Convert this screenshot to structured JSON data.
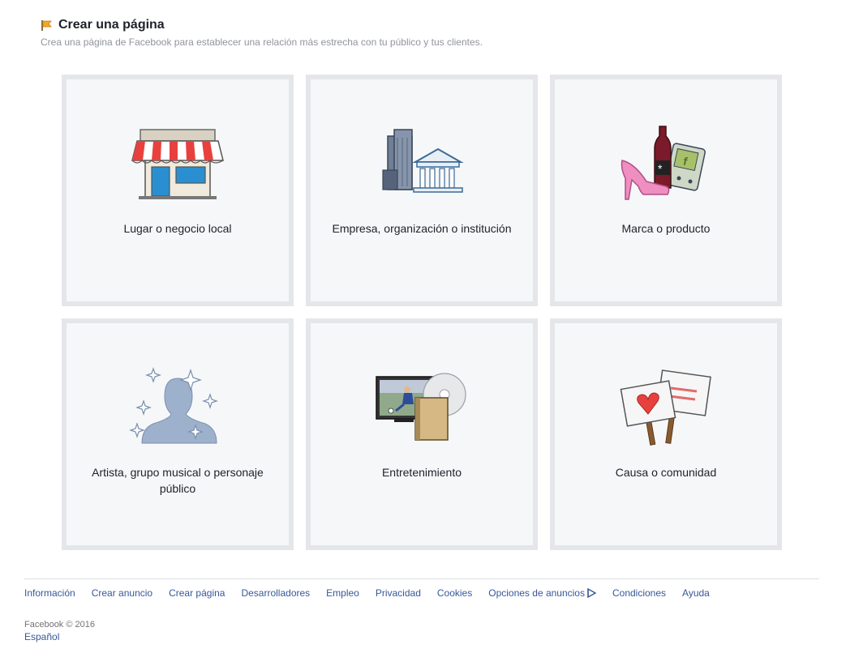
{
  "header": {
    "title": "Crear una página",
    "subtitle": "Crea una página de Facebook para establecer una relación más estrecha con tu público y tus clientes."
  },
  "categories": [
    {
      "label": "Lugar o negocio local",
      "icon": "storefront-icon"
    },
    {
      "label": "Empresa, organización o institución",
      "icon": "company-buildings-icon"
    },
    {
      "label": "Marca o producto",
      "icon": "brand-product-icon"
    },
    {
      "label": "Artista, grupo musical o personaje público",
      "icon": "artist-silhouette-icon"
    },
    {
      "label": "Entretenimiento",
      "icon": "entertainment-icon"
    },
    {
      "label": "Causa o comunidad",
      "icon": "cause-signs-icon"
    }
  ],
  "footer": {
    "links": [
      "Información",
      "Crear anuncio",
      "Crear página",
      "Desarrolladores",
      "Empleo",
      "Privacidad",
      "Cookies",
      "Opciones de anuncios",
      "Condiciones",
      "Ayuda"
    ],
    "copyright": "Facebook © 2016",
    "language": "Español"
  }
}
